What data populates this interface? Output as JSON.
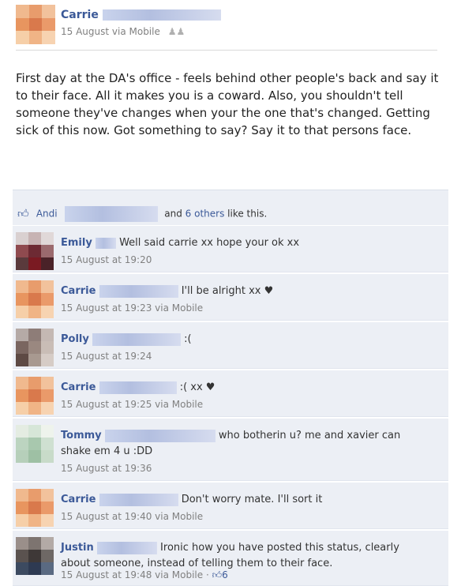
{
  "post": {
    "author": "Carrie",
    "meta": "15 August via Mobile",
    "body": "First day at the DA's office - feels behind other people's back and say it to their face. All it makes you is a coward. Also, you shouldn't tell someone they've changes when your the one that's changed. Getting sick of this now. Got something to say? Say it to that persons face."
  },
  "likes": {
    "liker": "Andi",
    "and_text": "and",
    "others": "6 others",
    "suffix": "like this."
  },
  "comments": [
    {
      "name": "Emily",
      "text": "Well said carrie xx hope your ok xx",
      "meta": "15 August at 19:20"
    },
    {
      "name": "Carrie",
      "text": "I'll be alright xx ♥",
      "meta": "15 August at 19:23 via Mobile"
    },
    {
      "name": "Polly",
      "text": ":(",
      "meta": "15 August at 19:24"
    },
    {
      "name": "Carrie",
      "text": ":( xx ♥",
      "meta": "15 August at 19:25 via Mobile"
    },
    {
      "name": "Tommy",
      "text": "who botherin u? me and xavier can shake em 4 u :DD",
      "meta": "15 August at 19:36"
    },
    {
      "name": "Carrie",
      "text": "Don't worry mate. I'll sort it",
      "meta": "15 August at 19:40 via Mobile"
    },
    {
      "name": "Justin",
      "text": "Ironic how you have posted this status, clearly about someone, instead of telling them to their face.",
      "meta": "15 August at 19:48 via Mobile ·",
      "like_count": "6"
    }
  ],
  "icons": {
    "friends": "friends-icon",
    "like": "thumbs-up-icon"
  },
  "colors": {
    "link": "#3b5998",
    "bar": "#eceff5"
  }
}
